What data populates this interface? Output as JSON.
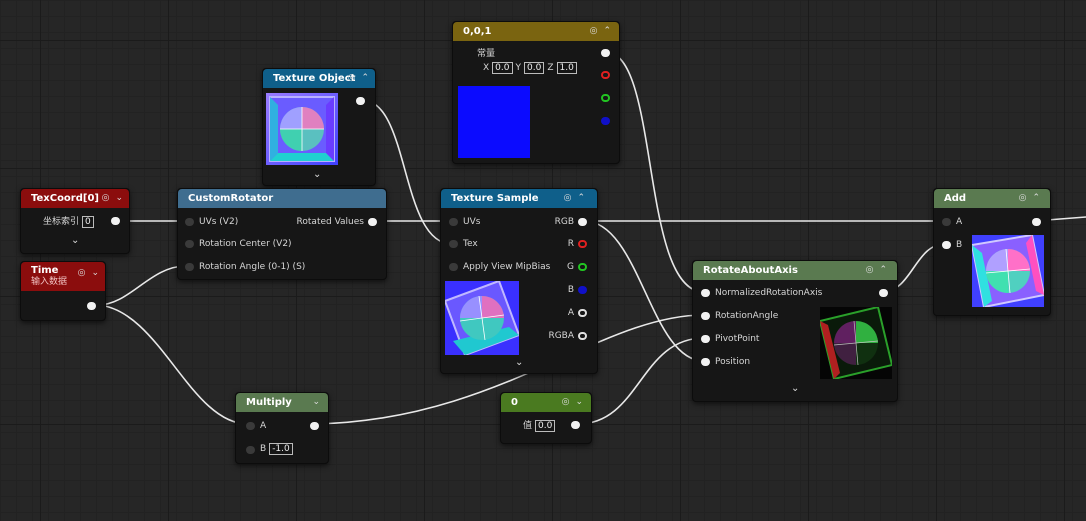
{
  "nodes": {
    "const3": {
      "title": "0,0,1",
      "sublabel": "常量",
      "x_label": "X",
      "x_val": "0.0",
      "y_label": "Y",
      "y_val": "0.0",
      "z_label": "Z",
      "z_val": "1.0",
      "color": "#7a6410"
    },
    "texobj": {
      "title": "Texture Object",
      "color": "#0f5f8a"
    },
    "texcoord": {
      "title": "TexCoord[0]",
      "index_label": "坐标索引",
      "index_val": "0",
      "color": "#8b0d0d"
    },
    "time": {
      "title": "Time",
      "subtitle": "输入数据",
      "color": "#8b0d0d"
    },
    "rotator": {
      "title": "CustomRotator",
      "pin_uvs": "UVs (V2)",
      "pin_center": "Rotation Center (V2)",
      "pin_angle": "Rotation Angle (0-1) (S)",
      "pin_out": "Rotated Values",
      "color": "#3f6d8f"
    },
    "texsample": {
      "title": "Texture Sample",
      "pin_uvs": "UVs",
      "pin_tex": "Tex",
      "pin_mip": "Apply View MipBias",
      "out_rgb": "RGB",
      "out_r": "R",
      "out_g": "G",
      "out_b": "B",
      "out_a": "A",
      "out_rgba": "RGBA",
      "color": "#0f5f8a"
    },
    "rotate": {
      "title": "RotateAboutAxis",
      "pin_axis": "NormalizedRotationAxis",
      "pin_angle": "RotationAngle",
      "pin_pivot": "PivotPoint",
      "pin_pos": "Position",
      "color": "#5a7a50"
    },
    "add": {
      "title": "Add",
      "pin_a": "A",
      "pin_b": "B",
      "color": "#5a7a50"
    },
    "multiply": {
      "title": "Multiply",
      "pin_a": "A",
      "pin_b": "B",
      "b_val": "-1.0",
      "color": "#5a7a50"
    },
    "zero": {
      "title": "0",
      "val_label": "值",
      "val": "0.0",
      "color": "#4a7a20"
    }
  },
  "colors": {
    "wire": "#e8e8e8",
    "swatch_blue": "#0b0bff"
  }
}
